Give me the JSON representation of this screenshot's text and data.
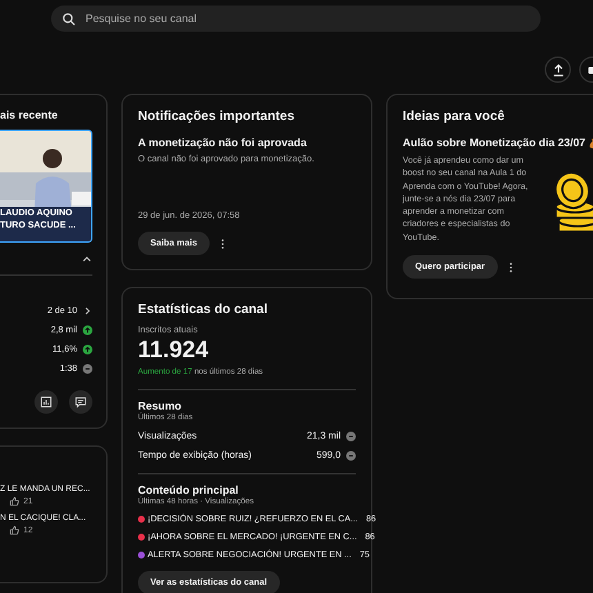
{
  "search": {
    "placeholder": "Pesquise no seu canal"
  },
  "recent_video": {
    "title": "ais recente",
    "thumbnail_caption": [
      "LAUDIO AQUINO",
      "TURO SACUDE ..."
    ],
    "expanded": true,
    "rows": [
      {
        "kind": "rank",
        "value": "2 de 10"
      },
      {
        "kind": "metric",
        "value": "2,8 mil",
        "increase": true
      },
      {
        "kind": "metric",
        "value": "11,6%",
        "increase": true
      },
      {
        "kind": "metric",
        "value": "1:38",
        "increase": false
      }
    ]
  },
  "recent_comments": [
    {
      "text": "Z LE MANDA UN REC...",
      "likes": "21"
    },
    {
      "text": "N EL CACIQUE! CLA...",
      "likes": "12"
    }
  ],
  "notifications": {
    "title": "Notificações importantes",
    "heading": "A monetização não foi aprovada",
    "body": "O canal não foi aprovado para monetização.",
    "date": "29 de jun. de 2026, 07:58",
    "button": "Saiba mais"
  },
  "stats": {
    "title": "Estatísticas do canal",
    "subscribers_label": "Inscritos atuais",
    "subscribers": "11.924",
    "growth_highlight": "Aumento de 17",
    "growth_rest": "nos últimos 28 dias",
    "summary": {
      "title": "Resumo",
      "subtitle": "Últimos 28 dias",
      "rows": [
        {
          "label": "Visualizações",
          "value": "21,3 mil",
          "increase": false
        },
        {
          "label": "Tempo de exibição (horas)",
          "value": "599,0",
          "increase": false
        }
      ]
    },
    "top_content": {
      "title": "Conteúdo principal",
      "subtitle": "Últimas 48 horas · Visualizações",
      "items": [
        {
          "title": "¡DECISIÓN SOBRE RUIZ! ¿REFUERZO EN EL CA...",
          "views": "86",
          "color": "#e8304a"
        },
        {
          "title": "¡AHORA SOBRE EL MERCADO! ¡URGENTE EN C...",
          "views": "86",
          "color": "#e8304a"
        },
        {
          "title": "ALERTA SOBRE NEGOCIACIÓN! URGENTE EN ...",
          "views": "75",
          "color": "#9a4fd6"
        }
      ]
    },
    "button": "Ver as estatísticas do canal"
  },
  "ideas": {
    "title": "Ideias para você",
    "heading": "Aulão sobre Monetização dia 23/07",
    "body": "Você já aprendeu como dar um boost no seu canal na Aula 1 do Aprenda com o YouTube! Agora, junte-se a nós dia 23/07 para aprender a monetizar com criadores e especialistas do YouTube.",
    "button": "Quero participar"
  }
}
